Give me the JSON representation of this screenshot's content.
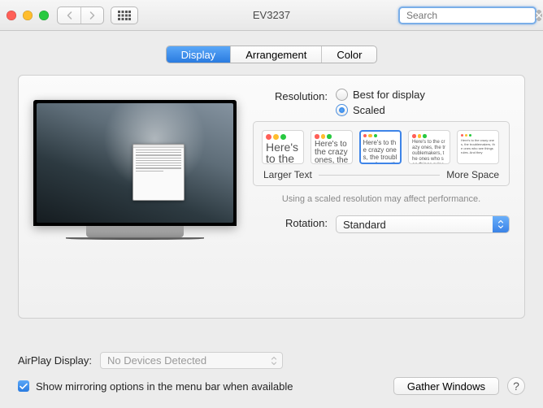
{
  "window": {
    "title": "EV3237"
  },
  "search": {
    "placeholder": "Search"
  },
  "tabs": [
    {
      "label": "Display",
      "active": true
    },
    {
      "label": "Arrangement",
      "active": false
    },
    {
      "label": "Color",
      "active": false
    }
  ],
  "resolution": {
    "label": "Resolution:",
    "options": [
      {
        "label": "Best for display",
        "checked": false
      },
      {
        "label": "Scaled",
        "checked": true
      }
    ],
    "scale": {
      "larger": "Larger Text",
      "more": "More Space",
      "sample": "Here's to the crazy ones, the troublemakers, the ones who see things rules. And they",
      "note": "Using a scaled resolution may affect performance."
    }
  },
  "rotation": {
    "label": "Rotation:",
    "value": "Standard"
  },
  "airplay": {
    "label": "AirPlay Display:",
    "value": "No Devices Detected"
  },
  "mirror": {
    "label": "Show mirroring options in the menu bar when available",
    "checked": true
  },
  "buttons": {
    "gather": "Gather Windows"
  }
}
